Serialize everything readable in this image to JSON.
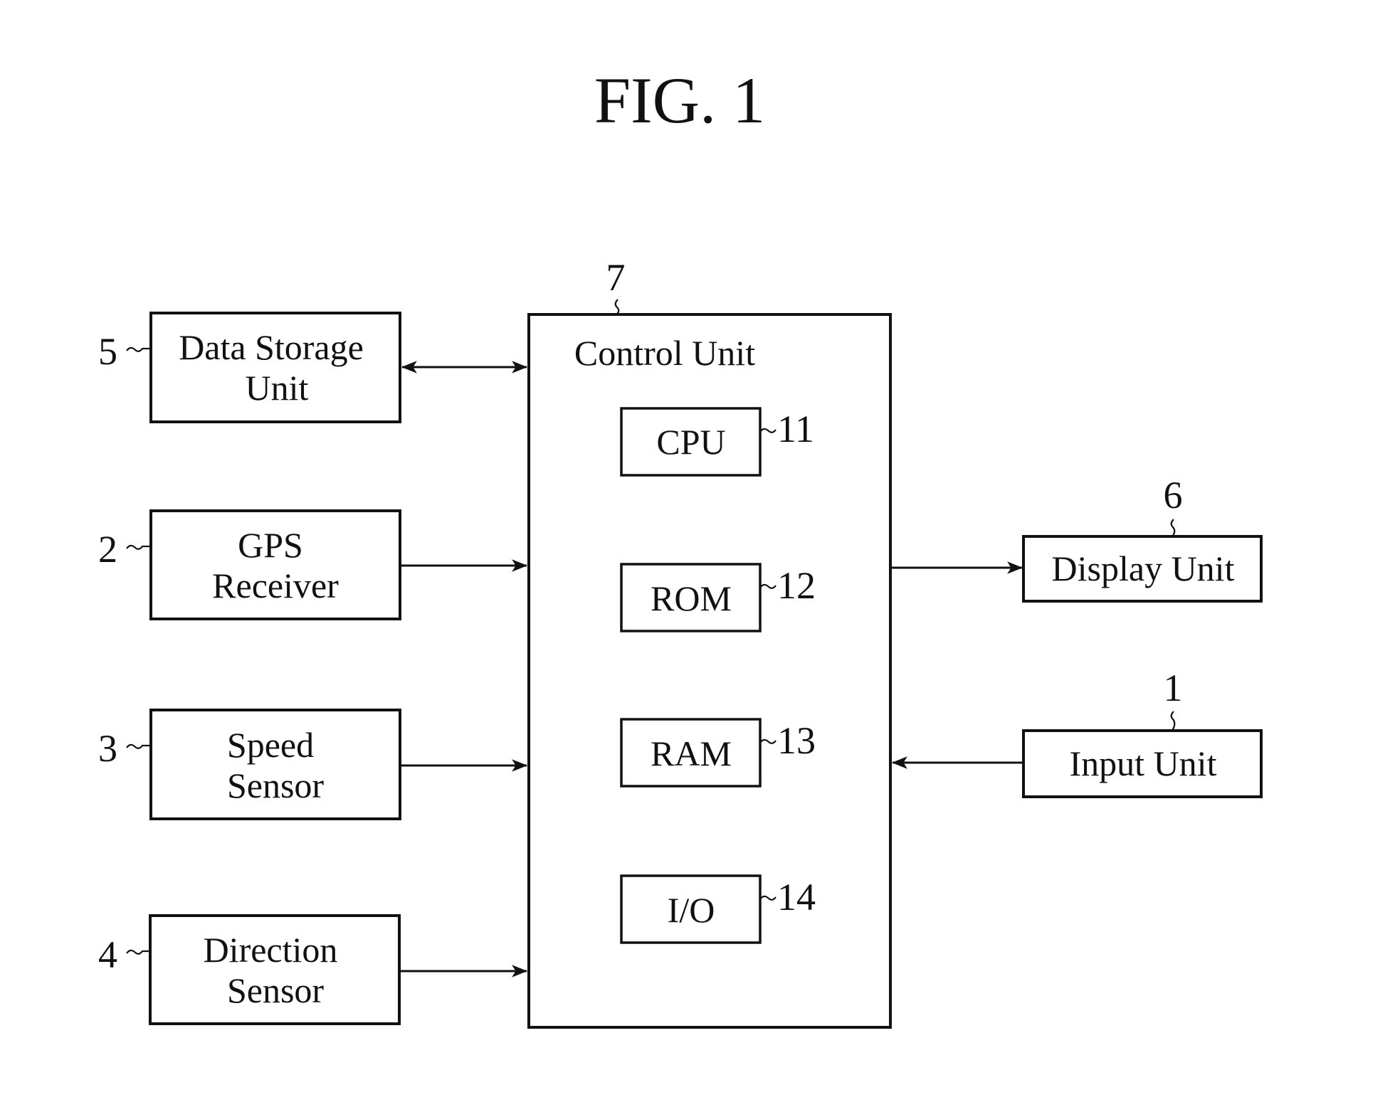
{
  "figure": {
    "title": "FIG. 1"
  },
  "blocks": {
    "data_storage": {
      "ref": "5",
      "line1": "Data Storage",
      "line2": "Unit"
    },
    "gps": {
      "ref": "2",
      "line1": "GPS",
      "line2": "Receiver"
    },
    "speed": {
      "ref": "3",
      "line1": "Speed",
      "line2": "Sensor"
    },
    "direction": {
      "ref": "4",
      "line1": "Direction",
      "line2": "Sensor"
    },
    "control": {
      "ref": "7",
      "label": "Control Unit"
    },
    "cpu": {
      "ref": "11",
      "label": "CPU"
    },
    "rom": {
      "ref": "12",
      "label": "ROM"
    },
    "ram": {
      "ref": "13",
      "label": "RAM"
    },
    "io": {
      "ref": "14",
      "label": "I/O"
    },
    "display": {
      "ref": "6",
      "label": "Display Unit"
    },
    "input": {
      "ref": "1",
      "label": "Input Unit"
    }
  },
  "connections": [
    {
      "from": "Data Storage Unit",
      "to": "Control Unit",
      "direction": "bidirectional"
    },
    {
      "from": "GPS Receiver",
      "to": "Control Unit",
      "direction": "one-way"
    },
    {
      "from": "Speed Sensor",
      "to": "Control Unit",
      "direction": "one-way"
    },
    {
      "from": "Direction Sensor",
      "to": "Control Unit",
      "direction": "one-way"
    },
    {
      "from": "Control Unit",
      "to": "Display Unit",
      "direction": "one-way"
    },
    {
      "from": "Input Unit",
      "to": "Control Unit",
      "direction": "one-way"
    }
  ]
}
